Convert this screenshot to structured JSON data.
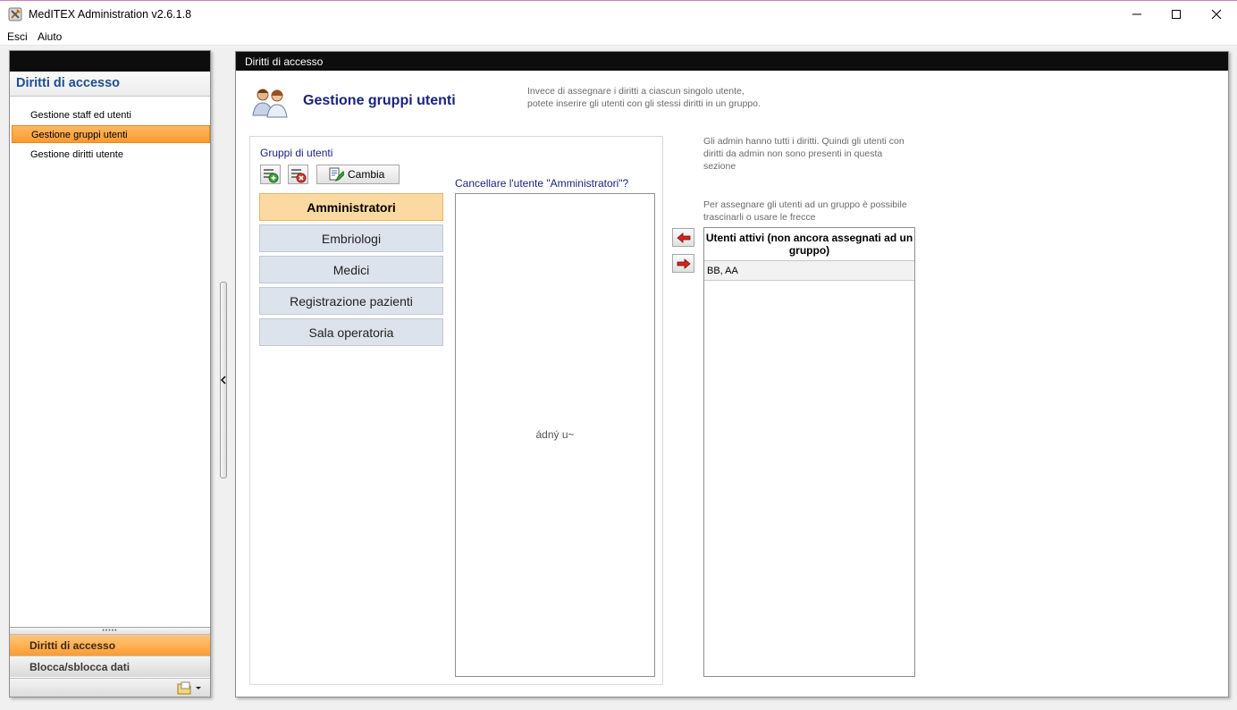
{
  "window": {
    "title": "MedITEX Administration v2.6.1.8"
  },
  "menu": {
    "items": [
      {
        "label": "Esci"
      },
      {
        "label": "Aiuto"
      }
    ]
  },
  "sidebar": {
    "header": "Diritti di accesso",
    "items": [
      {
        "label": "Gestione staff ed utenti",
        "active": false
      },
      {
        "label": "Gestione gruppi utenti",
        "active": true
      },
      {
        "label": "Gestione diritti utente",
        "active": false
      }
    ],
    "sections": [
      {
        "label": "Diritti di accesso",
        "active": true
      },
      {
        "label": "Blocca/sblocca dati",
        "active": false
      }
    ]
  },
  "main": {
    "panel_title": "Diritti di accesso",
    "heading": "Gestione gruppi utenti",
    "description_line1": "Invece di assegnare i diritti a ciascun singolo utente,",
    "description_line2": "potete inserire gli utenti con gli stessi diritti in un gruppo.",
    "groups_label": "Gruppi di utenti",
    "change_button": "Cambia",
    "groups": [
      {
        "label": "Amministratori",
        "active": true
      },
      {
        "label": "Embriologi",
        "active": false
      },
      {
        "label": "Medici",
        "active": false
      },
      {
        "label": "Registrazione pazienti",
        "active": false
      },
      {
        "label": "Sala operatoria",
        "active": false
      }
    ],
    "question": "Cancellare l'utente \"Amministratori\"?",
    "members_empty": "ádný u~",
    "info_admin_1": "Gli admin hanno tutti i diritti. Quindi gli utenti con",
    "info_admin_2": "diritti da admin non sono presenti in questa",
    "info_admin_3": "sezione",
    "info_assign_1": "Per assegnare gli utenti ad un gruppo è possibile",
    "info_assign_2": "trascinarli o usare le frecce",
    "active_users": {
      "header": "Utenti attivi (non ancora assegnati ad un gruppo)",
      "rows": [
        "BB, AA"
      ]
    }
  },
  "colors": {
    "accent_orange": "#ff9a2e",
    "title_blue": "#1a237e",
    "active_group": "#fbd9a0"
  },
  "icons": {
    "app": "tools-icon",
    "add_group": "add-group-icon",
    "delete_group": "delete-group-icon",
    "change": "edit-document-icon",
    "move_left": "red-arrow-left-icon",
    "move_right": "red-arrow-right-icon"
  }
}
